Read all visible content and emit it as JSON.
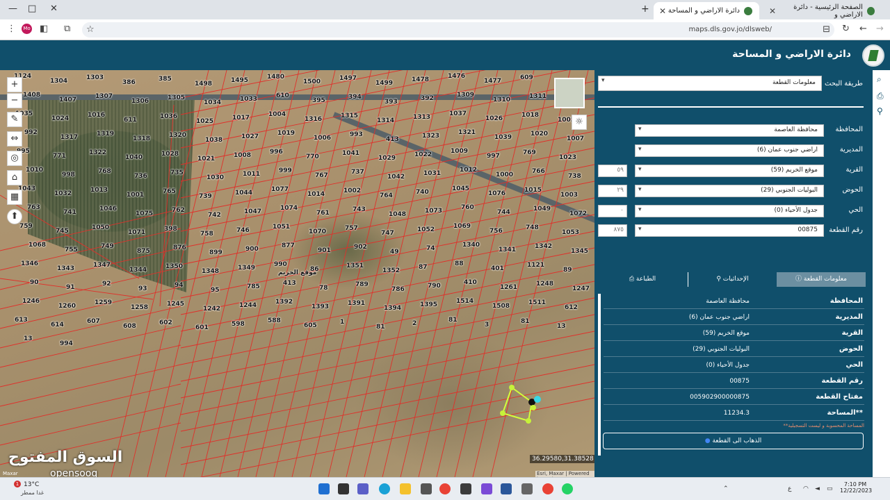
{
  "browser": {
    "tabs": [
      {
        "title": "الصفحة الرئيسية - دائرة الاراضي و"
      },
      {
        "title": "دائرة الاراضي و المساحة"
      }
    ],
    "url": "maps.dls.gov.jo/dlsweb/",
    "profile_initials": "Mo"
  },
  "app": {
    "title": "دائرة الاراضي و المساحة"
  },
  "search": {
    "method_label": "طريقة البحث",
    "method_value": "معلومات القطعة",
    "fields": [
      {
        "label": "المحافظة",
        "value": "محافظة العاصمة",
        "code": ""
      },
      {
        "label": "المديرية",
        "value": "اراضي جنوب عمان (6)",
        "code": ""
      },
      {
        "label": "القرية",
        "value": "موقع الخريم (59)",
        "code": "٥٩"
      },
      {
        "label": "الحوض",
        "value": "البوليات الجنوبي (29)",
        "code": "٢٩"
      },
      {
        "label": "الحي",
        "value": "جدول الأحياء (0)",
        "code": "٠"
      },
      {
        "label": "رقم القطعة",
        "value": "00875",
        "code": "٨٧٥"
      }
    ]
  },
  "info_tabs": [
    {
      "label": "معلومات القطعة",
      "icon": "info-icon"
    },
    {
      "label": "الإحداثيات",
      "icon": "pin-icon"
    },
    {
      "label": "الطباعة",
      "icon": "print-icon"
    }
  ],
  "parcel_info": [
    {
      "key": "المحافظة",
      "value": "محافظة العاصمة"
    },
    {
      "key": "المديرية",
      "value": "اراضي جنوب عمان (6)"
    },
    {
      "key": "القرية",
      "value": "موقع الخريم (59)"
    },
    {
      "key": "الحوض",
      "value": "البوليات الجنوبي (29)"
    },
    {
      "key": "الحي",
      "value": "جدول الأحياء (0)"
    },
    {
      "key": "رقم القطعة",
      "value": "00875"
    },
    {
      "key": "مفتاح القطعة",
      "value": "005902900000875"
    },
    {
      "key": "المساحة**",
      "value": "11234.3"
    }
  ],
  "note": "**المساحة المحسوبة و ليست التسجيلية",
  "go_button": "الذهاب الى القطعة",
  "map": {
    "coordinates": "36.29580,31.38528",
    "watermark": "السوق المفتوح",
    "watermark_sub": "opensooq",
    "attribution": "Esri, Maxar | Powered by Esri",
    "provider": "Maxar",
    "place_name": "موقع الخريم",
    "parcel_labels": [
      {
        "t": "1124"
      },
      {
        "t": "1304"
      },
      {
        "t": "1303"
      },
      {
        "t": "386"
      },
      {
        "t": "385"
      },
      {
        "t": "1498"
      },
      {
        "t": "1495"
      },
      {
        "t": "1480"
      },
      {
        "t": "1500"
      },
      {
        "t": "1497"
      },
      {
        "t": "1499"
      },
      {
        "t": "1478"
      },
      {
        "t": "1476"
      },
      {
        "t": "1477"
      },
      {
        "t": "609"
      },
      {
        "t": "600"
      },
      {
        "t": "1408"
      },
      {
        "t": "1407"
      },
      {
        "t": "1307"
      },
      {
        "t": "1306"
      },
      {
        "t": "1305"
      },
      {
        "t": "1034"
      },
      {
        "t": "1033"
      },
      {
        "t": "610"
      },
      {
        "t": "395"
      },
      {
        "t": "394"
      },
      {
        "t": "393"
      },
      {
        "t": "392"
      },
      {
        "t": "1309"
      },
      {
        "t": "1310"
      },
      {
        "t": "1311"
      },
      {
        "t": "1312"
      },
      {
        "t": "1035"
      },
      {
        "t": "1024"
      },
      {
        "t": "1016"
      },
      {
        "t": "611"
      },
      {
        "t": "1036"
      },
      {
        "t": "1025"
      },
      {
        "t": "1017"
      },
      {
        "t": "1004"
      },
      {
        "t": "1316"
      },
      {
        "t": "1315"
      },
      {
        "t": "1314"
      },
      {
        "t": "1313"
      },
      {
        "t": "1037"
      },
      {
        "t": "1026"
      },
      {
        "t": "1018"
      },
      {
        "t": "1005"
      },
      {
        "t": "992"
      },
      {
        "t": "1317"
      },
      {
        "t": "1319"
      },
      {
        "t": "1318"
      },
      {
        "t": "1320"
      },
      {
        "t": "1038"
      },
      {
        "t": "1027"
      },
      {
        "t": "1019"
      },
      {
        "t": "1006"
      },
      {
        "t": "993"
      },
      {
        "t": "413"
      },
      {
        "t": "1323"
      },
      {
        "t": "1321"
      },
      {
        "t": "1039"
      },
      {
        "t": "1020"
      },
      {
        "t": "1007"
      },
      {
        "t": "995"
      },
      {
        "t": "771"
      },
      {
        "t": "1322"
      },
      {
        "t": "1040"
      },
      {
        "t": "1028"
      },
      {
        "t": "1021"
      },
      {
        "t": "1008"
      },
      {
        "t": "996"
      },
      {
        "t": "770"
      },
      {
        "t": "1041"
      },
      {
        "t": "1029"
      },
      {
        "t": "1022"
      },
      {
        "t": "1009"
      },
      {
        "t": "997"
      },
      {
        "t": "769"
      },
      {
        "t": "1023"
      },
      {
        "t": "1010"
      },
      {
        "t": "998"
      },
      {
        "t": "768"
      },
      {
        "t": "736"
      },
      {
        "t": "735"
      },
      {
        "t": "1030"
      },
      {
        "t": "1011"
      },
      {
        "t": "999"
      },
      {
        "t": "767"
      },
      {
        "t": "737"
      },
      {
        "t": "1042"
      },
      {
        "t": "1031"
      },
      {
        "t": "1012"
      },
      {
        "t": "1000"
      },
      {
        "t": "766"
      },
      {
        "t": "738"
      },
      {
        "t": "1043"
      },
      {
        "t": "1032"
      },
      {
        "t": "1013"
      },
      {
        "t": "1001"
      },
      {
        "t": "765"
      },
      {
        "t": "739"
      },
      {
        "t": "1044"
      },
      {
        "t": "1077"
      },
      {
        "t": "1014"
      },
      {
        "t": "1002"
      },
      {
        "t": "764"
      },
      {
        "t": "740"
      },
      {
        "t": "1045"
      },
      {
        "t": "1076"
      },
      {
        "t": "1015"
      },
      {
        "t": "1003"
      },
      {
        "t": "763"
      },
      {
        "t": "741"
      },
      {
        "t": "1046"
      },
      {
        "t": "1075"
      },
      {
        "t": "762"
      },
      {
        "t": "742"
      },
      {
        "t": "1047"
      },
      {
        "t": "1074"
      },
      {
        "t": "761"
      },
      {
        "t": "743"
      },
      {
        "t": "1048"
      },
      {
        "t": "1073"
      },
      {
        "t": "760"
      },
      {
        "t": "744"
      },
      {
        "t": "1049"
      },
      {
        "t": "1072"
      },
      {
        "t": "759"
      },
      {
        "t": "745"
      },
      {
        "t": "1050"
      },
      {
        "t": "1071"
      },
      {
        "t": "398"
      },
      {
        "t": "758"
      },
      {
        "t": "746"
      },
      {
        "t": "1051"
      },
      {
        "t": "1070"
      },
      {
        "t": "757"
      },
      {
        "t": "747"
      },
      {
        "t": "1052"
      },
      {
        "t": "1069"
      },
      {
        "t": "756"
      },
      {
        "t": "748"
      },
      {
        "t": "1053"
      },
      {
        "t": "1068"
      },
      {
        "t": "755"
      },
      {
        "t": "749"
      },
      {
        "t": "875"
      },
      {
        "t": "876"
      },
      {
        "t": "899"
      },
      {
        "t": "900"
      },
      {
        "t": "877"
      },
      {
        "t": "901"
      },
      {
        "t": "902"
      },
      {
        "t": "49"
      },
      {
        "t": "74"
      },
      {
        "t": "1340"
      },
      {
        "t": "1341"
      },
      {
        "t": "1342"
      },
      {
        "t": "1345"
      },
      {
        "t": "1346"
      },
      {
        "t": "1343"
      },
      {
        "t": "1347"
      },
      {
        "t": "1344"
      },
      {
        "t": "1350"
      },
      {
        "t": "1348"
      },
      {
        "t": "1349"
      },
      {
        "t": "990"
      },
      {
        "t": "86"
      },
      {
        "t": "1351"
      },
      {
        "t": "1352"
      },
      {
        "t": "87"
      },
      {
        "t": "88"
      },
      {
        "t": "401"
      },
      {
        "t": "1121"
      },
      {
        "t": "89"
      },
      {
        "t": "90"
      },
      {
        "t": "91"
      },
      {
        "t": "92"
      },
      {
        "t": "93"
      },
      {
        "t": "94"
      },
      {
        "t": "95"
      },
      {
        "t": "785"
      },
      {
        "t": "413"
      },
      {
        "t": "78"
      },
      {
        "t": "789"
      },
      {
        "t": "786"
      },
      {
        "t": "790"
      },
      {
        "t": "410"
      },
      {
        "t": "1261"
      },
      {
        "t": "1248"
      },
      {
        "t": "1247"
      },
      {
        "t": "1246"
      },
      {
        "t": "1260"
      },
      {
        "t": "1259"
      },
      {
        "t": "1258"
      },
      {
        "t": "1245"
      },
      {
        "t": "1242"
      },
      {
        "t": "1244"
      },
      {
        "t": "1392"
      },
      {
        "t": "1393"
      },
      {
        "t": "1391"
      },
      {
        "t": "1394"
      },
      {
        "t": "1395"
      },
      {
        "t": "1514"
      },
      {
        "t": "1508"
      },
      {
        "t": "1511"
      },
      {
        "t": "612"
      },
      {
        "t": "613"
      },
      {
        "t": "614"
      },
      {
        "t": "607"
      },
      {
        "t": "608"
      },
      {
        "t": "602"
      },
      {
        "t": "601"
      },
      {
        "t": "598"
      },
      {
        "t": "588"
      },
      {
        "t": "605"
      },
      {
        "t": "1"
      },
      {
        "t": "81"
      },
      {
        "t": "2"
      },
      {
        "t": "81"
      },
      {
        "t": "3"
      },
      {
        "t": "81"
      },
      {
        "t": "13"
      },
      {
        "t": "13"
      },
      {
        "t": "994"
      }
    ]
  },
  "taskbar": {
    "temperature": "13°C",
    "weather": "غدا ممطر",
    "time": "7:10 PM",
    "date": "12/22/2023",
    "lang": "ع",
    "badge": "1"
  }
}
